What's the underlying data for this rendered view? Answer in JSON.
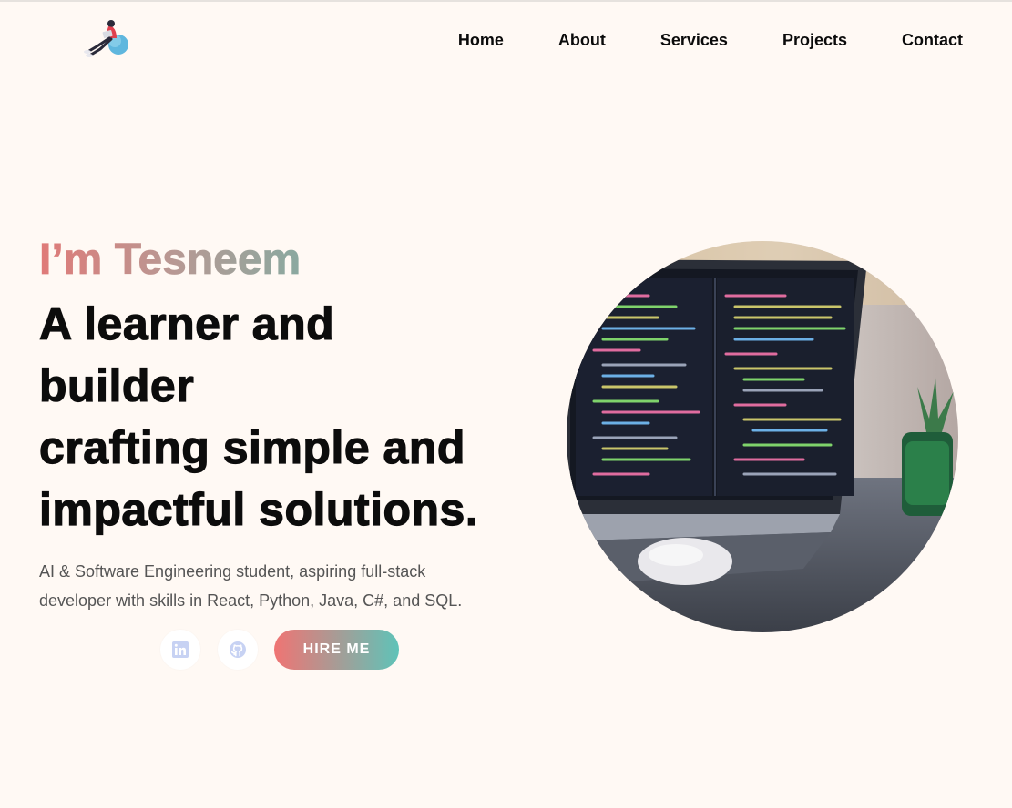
{
  "header": {
    "logo_icon": "person-with-laptop-illustration",
    "nav": [
      {
        "label": "Home"
      },
      {
        "label": "About"
      },
      {
        "label": "Services"
      },
      {
        "label": "Projects"
      },
      {
        "label": "Contact"
      }
    ]
  },
  "hero": {
    "greeting": "I’m Tesneem",
    "headline": [
      "A learner and",
      "builder",
      "crafting simple and",
      "impactful solutions."
    ],
    "intro_lines": [
      "AI & Software Engineering student, aspiring full-stack",
      "developer with skills in React, Python, Java, C#, and SQL."
    ],
    "social": [
      {
        "icon": "linkedin-icon"
      },
      {
        "icon": "github-icon"
      }
    ],
    "cta_label": "HIRE ME",
    "image_subject": "laptop-with-code-editor",
    "colors": {
      "background": "#fff9f4",
      "gradient_start": "#f07473",
      "gradient_end": "#5fc3b8",
      "social_icon": "#c7d2f3"
    }
  }
}
